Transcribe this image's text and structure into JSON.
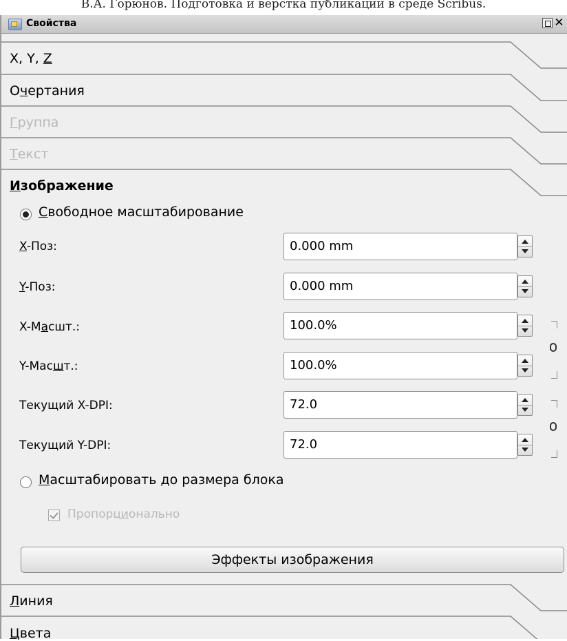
{
  "doc_header": "В.А. Горюнов. Подготовка и верстка публикации в среде Scribus.",
  "window": {
    "title": "Свойства",
    "float_button": "",
    "close_button": "✕"
  },
  "tabs": {
    "xyz": {
      "pre": "X, Y, ",
      "key": "Z",
      "post": ""
    },
    "shape": {
      "pre": "О",
      "key": "ч",
      "post": "ертания"
    },
    "group": {
      "pre": "",
      "key": "Г",
      "post": "руппа"
    },
    "text": {
      "pre": "",
      "key": "Т",
      "post": "екст"
    },
    "image": {
      "pre": "",
      "key": "И",
      "post": "зображение"
    },
    "line": {
      "pre": "",
      "key": "Л",
      "post": "иния"
    },
    "colors": {
      "pre": "",
      "key": "Ц",
      "post": "вета"
    }
  },
  "image_section": {
    "free_scaling": {
      "pre": "",
      "key": "С",
      "post": "вободное масштабирование",
      "checked": true
    },
    "fields": {
      "x_pos": {
        "pre": "",
        "key": "X",
        "post": "-Поз:",
        "value": "0.000 mm"
      },
      "y_pos": {
        "pre": "",
        "key": "Y",
        "post": "-Поз:",
        "value": "0.000 mm"
      },
      "x_scale": {
        "pre": "X-М",
        "key": "а",
        "post": "сшт.:",
        "value": "100.0%"
      },
      "y_scale": {
        "pre": "Y-Мас",
        "key": "ш",
        "post": "т.:",
        "value": "100.0%"
      },
      "x_dpi": {
        "pre": "Текущий X-DPI:",
        "key": "",
        "post": "",
        "value": "72.0"
      },
      "y_dpi": {
        "pre": "Текущий Y-DPI:",
        "key": "",
        "post": "",
        "value": "72.0"
      }
    },
    "fit_frame": {
      "pre": "",
      "key": "М",
      "post": "асштабировать до размера блока",
      "checked": false
    },
    "proportional": {
      "pre": "Пропорц",
      "key": "и",
      "post": "онально",
      "checked": true,
      "enabled": false
    },
    "effects_button": "Эффекты изображения"
  },
  "icons": {
    "link_scale": "chain-link-icon",
    "link_dpi": "chain-link-icon"
  }
}
